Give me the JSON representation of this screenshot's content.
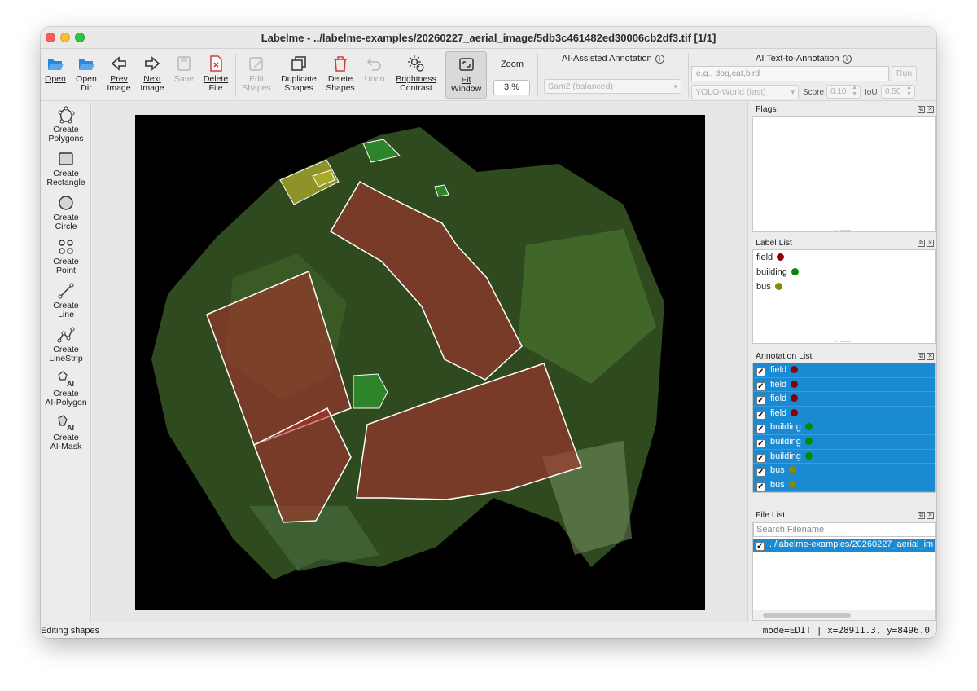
{
  "window": {
    "title": "Labelme - ../labelme-examples/20260227_aerial_image/5db3c461482ed30006cb2df3.tif [1/1]"
  },
  "toolbar": {
    "open": "Open",
    "open_dir": [
      "Open",
      "Dir"
    ],
    "prev_image": [
      "Prev",
      "Image"
    ],
    "next_image": [
      "Next",
      "Image"
    ],
    "save": "Save",
    "delete_file": [
      "Delete",
      "File"
    ],
    "edit_shapes": [
      "Edit",
      "Shapes"
    ],
    "duplicate_shapes": [
      "Duplicate",
      "Shapes"
    ],
    "delete_shapes": [
      "Delete",
      "Shapes"
    ],
    "undo": "Undo",
    "brightness_contrast": [
      "Brightness",
      "Contrast"
    ],
    "fit_window": [
      "Fit",
      "Window"
    ],
    "zoom_label": "Zoom",
    "zoom_value": "3 %"
  },
  "ai_assisted": {
    "title": "AI-Assisted Annotation",
    "model": "Sam2 (balanced)"
  },
  "ai_text": {
    "title": "AI Text-to-Annotation",
    "prompt_placeholder": "e.g., dog,cat,bird",
    "run": "Run",
    "model": "YOLO-World (fast)",
    "score_label": "Score",
    "score_value": "0.10",
    "iou_label": "IoU",
    "iou_value": "0.50"
  },
  "leftbar": {
    "create_polygons": [
      "Create",
      "Polygons"
    ],
    "create_rectangle": [
      "Create",
      "Rectangle"
    ],
    "create_circle": [
      "Create",
      "Circle"
    ],
    "create_point": [
      "Create",
      "Point"
    ],
    "create_line": [
      "Create",
      "Line"
    ],
    "create_linestrip": [
      "Create",
      "LineStrip"
    ],
    "create_ai_polygon": [
      "Create",
      "AI-Polygon"
    ],
    "create_ai_mask": [
      "Create",
      "AI-Mask"
    ]
  },
  "docks": {
    "flags_title": "Flags",
    "label_list_title": "Label List",
    "annotation_list_title": "Annotation List",
    "file_list_title": "File List"
  },
  "label_list": [
    {
      "name": "field",
      "color": "#8b0000"
    },
    {
      "name": "building",
      "color": "#008a00"
    },
    {
      "name": "bus",
      "color": "#8a8a00"
    }
  ],
  "annotations": [
    {
      "label": "field",
      "color": "#8b0000",
      "checked": true
    },
    {
      "label": "field",
      "color": "#8b0000",
      "checked": true
    },
    {
      "label": "field",
      "color": "#8b0000",
      "checked": true
    },
    {
      "label": "field",
      "color": "#8b0000",
      "checked": true
    },
    {
      "label": "building",
      "color": "#008a00",
      "checked": true
    },
    {
      "label": "building",
      "color": "#008a00",
      "checked": true
    },
    {
      "label": "building",
      "color": "#008a00",
      "checked": true
    },
    {
      "label": "bus",
      "color": "#8a8a00",
      "checked": true
    },
    {
      "label": "bus",
      "color": "#8a8a00",
      "checked": true
    }
  ],
  "file_list": {
    "search_placeholder": "Search Filename",
    "files": [
      "../labelme-examples/20260227_aerial_im"
    ]
  },
  "status": {
    "left": "Editing shapes",
    "right": "mode=EDIT | x=28911.3, y=8496.0"
  }
}
